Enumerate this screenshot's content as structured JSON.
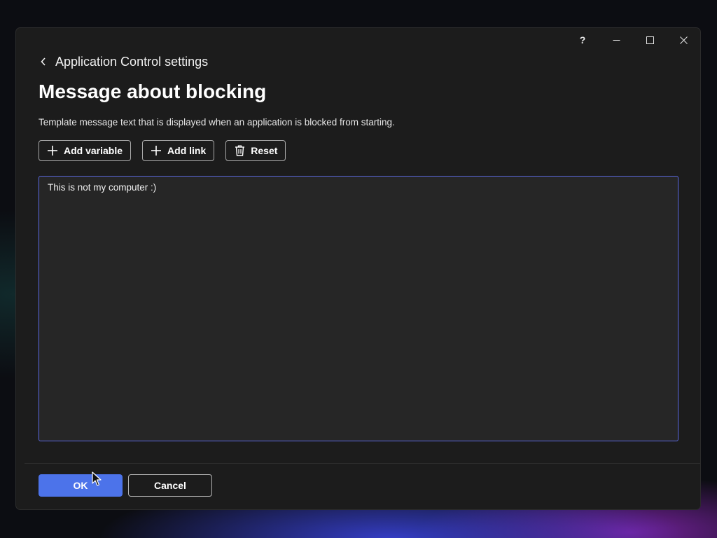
{
  "window": {
    "help_label": "?",
    "icons": [
      "minimize-icon",
      "maximize-icon",
      "close-icon"
    ]
  },
  "header": {
    "back_label": "Application Control settings",
    "title": "Message about blocking",
    "description": "Template message text that is displayed when an application is blocked from starting."
  },
  "toolbar": {
    "add_variable_label": "Add variable",
    "add_link_label": "Add link",
    "reset_label": "Reset"
  },
  "editor": {
    "value": "This is not my computer :)"
  },
  "footer": {
    "ok_label": "OK",
    "cancel_label": "Cancel"
  },
  "colors": {
    "accent": "#4c73ea",
    "window_bg": "#1c1c1c",
    "editor_border": "#5a68e0"
  }
}
